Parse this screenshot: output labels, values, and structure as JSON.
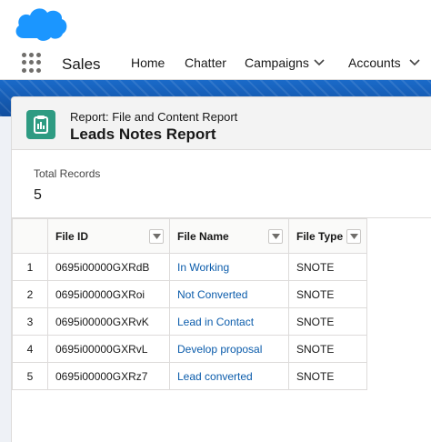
{
  "header": {
    "app_name": "Sales",
    "nav": [
      {
        "label": "Home"
      },
      {
        "label": "Chatter"
      },
      {
        "label": "Campaigns"
      },
      {
        "label": "Accounts"
      }
    ]
  },
  "report": {
    "kicker": "Report: File and Content Report",
    "title": "Leads Notes Report",
    "summary_label": "Total Records",
    "summary_value": "5"
  },
  "table": {
    "columns": [
      "File ID",
      "File Name",
      "File Type"
    ],
    "rows": [
      {
        "num": "1",
        "file_id": "0695i00000GXRdB",
        "file_name": "In Working",
        "file_type": "SNOTE"
      },
      {
        "num": "2",
        "file_id": "0695i00000GXRoi",
        "file_name": "Not Converted",
        "file_type": "SNOTE"
      },
      {
        "num": "3",
        "file_id": "0695i00000GXRvK",
        "file_name": "Lead in Contact",
        "file_type": "SNOTE"
      },
      {
        "num": "4",
        "file_id": "0695i00000GXRvL",
        "file_name": "Develop proposal",
        "file_type": "SNOTE"
      },
      {
        "num": "5",
        "file_id": "0695i00000GXRz7",
        "file_name": "Lead converted",
        "file_type": "SNOTE"
      }
    ]
  },
  "colors": {
    "brand_blue": "#1b96ff",
    "banner_blue": "#1a6ac9",
    "report_icon": "#2e9b82",
    "link": "#0b5cab"
  }
}
